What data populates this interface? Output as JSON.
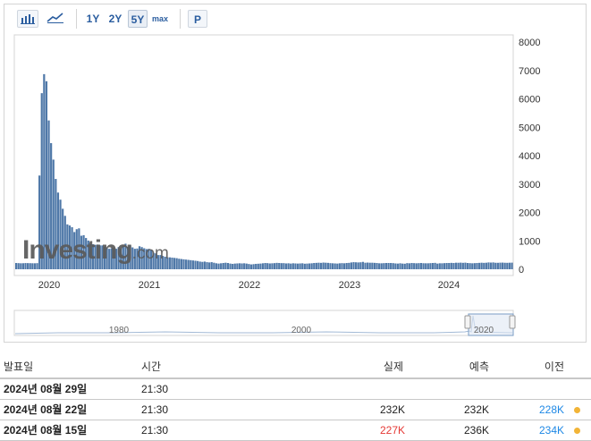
{
  "colors": {
    "bar": "#4f78a8",
    "bar_light": "#a3bad6",
    "axis_text": "#333333",
    "link_blue": "#1e88e5",
    "negative_red": "#e53935",
    "dot_orange": "#f2b437"
  },
  "toolbar": {
    "bar_icon": "bar-chart-icon",
    "line_icon": "line-chart-icon",
    "ranges": [
      "1Y",
      "2Y",
      "5Y",
      "max"
    ],
    "active_range": "5Y",
    "p_label": "P"
  },
  "watermark": {
    "brand": "Investing",
    "suffix": ".com"
  },
  "chart_data": {
    "type": "bar",
    "x_tick_labels": [
      "2020",
      "2021",
      "2022",
      "2023",
      "2024"
    ],
    "y_tick_labels": [
      "8000",
      "7000",
      "6000",
      "5000",
      "4000",
      "3000",
      "2000",
      "1000",
      "0"
    ],
    "ylim": [
      0,
      8000
    ],
    "grid": false,
    "weekly_values_thousands": [
      220,
      215,
      210,
      212,
      218,
      216,
      214,
      211,
      210,
      215,
      3300,
      6200,
      6870,
      6620,
      5240,
      4440,
      3860,
      3180,
      2700,
      2450,
      2130,
      1880,
      1580,
      1540,
      1480,
      1310,
      1410,
      1440,
      1180,
      1200,
      1100,
      1010,
      880,
      880,
      860,
      870,
      840,
      840,
      790,
      750,
      720,
      740,
      750,
      720,
      780,
      720,
      830,
      900,
      790,
      840,
      770,
      720,
      730,
      810,
      780,
      740,
      710,
      720,
      680,
      580,
      560,
      500,
      500,
      470,
      440,
      420,
      420,
      410,
      400,
      390,
      370,
      360,
      350,
      340,
      330,
      320,
      310,
      300,
      290,
      270,
      260,
      270,
      250,
      240,
      250,
      230,
      210,
      200,
      210,
      220,
      230,
      220,
      200,
      190,
      200,
      205,
      210,
      205,
      210,
      200,
      185,
      170,
      180,
      190,
      195,
      200,
      210,
      220,
      215,
      205,
      210,
      215,
      225,
      220,
      215,
      215,
      205,
      210,
      200,
      210,
      205,
      200,
      205,
      210,
      195,
      200,
      205,
      210,
      220,
      225,
      230,
      225,
      235,
      230,
      225,
      215,
      210,
      205,
      200,
      210,
      215,
      210,
      220,
      225,
      240,
      250,
      245,
      240,
      245,
      260,
      230,
      235,
      230,
      230,
      225,
      220,
      210,
      210,
      215,
      220,
      220,
      220,
      215,
      205,
      200,
      210,
      200,
      195,
      215,
      210,
      220,
      215,
      210,
      215,
      220,
      212,
      210,
      210,
      215,
      220,
      225,
      200,
      210,
      210,
      215,
      220,
      220,
      225,
      220,
      230,
      228,
      232,
      226,
      232,
      220,
      215,
      210,
      215,
      220,
      225,
      230,
      225,
      230,
      240,
      235,
      240,
      228,
      227,
      232,
      234,
      228,
      226,
      230,
      232
    ],
    "navigator_tick_labels": [
      "1980",
      "2000",
      "2020"
    ]
  },
  "table": {
    "headers": {
      "date": "발표일",
      "time": "시간",
      "actual": "실제",
      "forecast": "예측",
      "previous": "이전"
    },
    "rows": [
      {
        "date": "2024년 08월 29일",
        "time": "21:30",
        "actual": "",
        "forecast": "",
        "previous": "",
        "actual_color": "",
        "prev_color": "",
        "dot": false
      },
      {
        "date": "2024년 08월 22일",
        "time": "21:30",
        "actual": "232K",
        "forecast": "232K",
        "previous": "228K",
        "actual_color": "#222222",
        "prev_color": "#1e88e5",
        "dot": true
      },
      {
        "date": "2024년 08월 15일",
        "time": "21:30",
        "actual": "227K",
        "forecast": "236K",
        "previous": "234K",
        "actual_color": "#e53935",
        "prev_color": "#1e88e5",
        "dot": true
      }
    ]
  }
}
